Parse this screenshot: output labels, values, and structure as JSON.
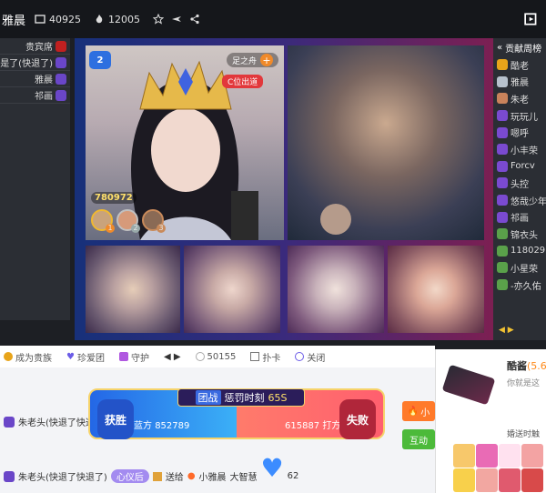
{
  "header": {
    "streamer": "雅晨",
    "room_id": "40925",
    "popularity": "12005"
  },
  "left_panel": {
    "items": [
      {
        "label": "贵宾席",
        "badge_color": "#c02020"
      },
      {
        "label": "是了(快退了)",
        "badge_color": "#6a46c8"
      },
      {
        "label": "雅晨",
        "badge_color": "#6a46c8"
      },
      {
        "label": "祁画",
        "badge_color": "#6a46c8"
      }
    ]
  },
  "stage": {
    "main_anchor": {
      "name": "足之舟",
      "slot_label": "C位出道",
      "score": "780972",
      "ranks": [
        "1",
        "2",
        "3"
      ],
      "level": "2"
    },
    "colors": {
      "left": "#17307a",
      "right": "#7c1f52"
    }
  },
  "right_panel": {
    "title": "贡献周榜",
    "items": [
      "酷老",
      "雅晨",
      "朱老",
      "玩玩儿",
      "嗯呼",
      "小丰荣",
      "Forcv",
      "头控",
      "悠哉少年",
      "祁画",
      "锦衣头",
      "118029",
      "小星荣",
      "-亦久佑"
    ]
  },
  "toolbar": {
    "items": [
      "成为贵族",
      "珍爱团",
      "守护",
      "50155",
      "扑卡",
      "关闭"
    ]
  },
  "pk": {
    "title": "惩罚时刻",
    "timer": "65S",
    "tag": "团战",
    "left_label": "获胜",
    "right_label": "失败",
    "left_team": "蓝方",
    "left_score": "852789",
    "right_score": "615887",
    "right_team": "打方"
  },
  "chat": {
    "messages": [
      {
        "user": "朱老头(快退了快退了)",
        "text": ""
      },
      {
        "user": "朱老头(快退了快退了)",
        "badge": "心仪后",
        "extra": "送给",
        "target": "小雅晨",
        "gift": "大智慧",
        "count": "62"
      }
    ]
  },
  "popup": {
    "title": "酷酱",
    "level": "(5.6",
    "desc": "你就是这",
    "footer": "婚送时触"
  },
  "buttons": {
    "follow": "小",
    "interact": "互动"
  }
}
